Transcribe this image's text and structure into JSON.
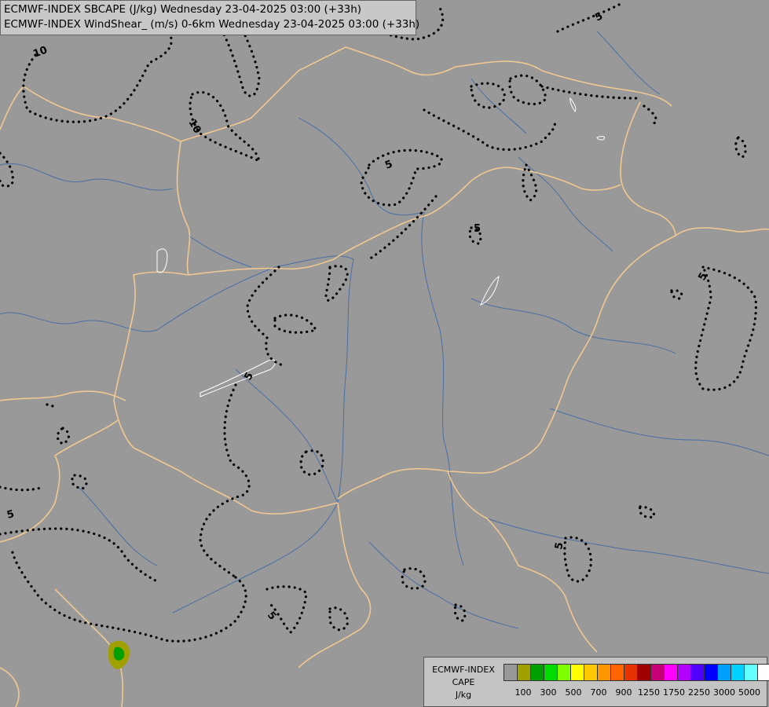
{
  "header": {
    "line1": "ECMWF-INDEX SBCAPE (J/kg) Wednesday 23-04-2025 03:00 (+33h)",
    "line2": "ECMWF-INDEX WindShear_ (m/s) 0-6km Wednesday 23-04-2025 03:00 (+33h)"
  },
  "legend": {
    "title_lines": [
      "ECMWF-INDEX",
      "CAPE",
      "J/kg"
    ],
    "colors": [
      "#999999",
      "#a0a000",
      "#00a000",
      "#00dc00",
      "#80ff00",
      "#ffff00",
      "#ffc800",
      "#ff9600",
      "#ff6400",
      "#e63200",
      "#a00000",
      "#c80078",
      "#ff00ff",
      "#b400ff",
      "#5000ff",
      "#0000ff",
      "#00a0ff",
      "#00d2ff",
      "#64ffff",
      "#ffffff"
    ],
    "ticks": [
      "100",
      "300",
      "500",
      "700",
      "900",
      "1250",
      "1750",
      "2250",
      "3000",
      "5000"
    ]
  },
  "contour_labels": [
    "5",
    "5",
    "10",
    "10",
    "5",
    "5",
    "5",
    "5",
    "5",
    "5"
  ]
}
